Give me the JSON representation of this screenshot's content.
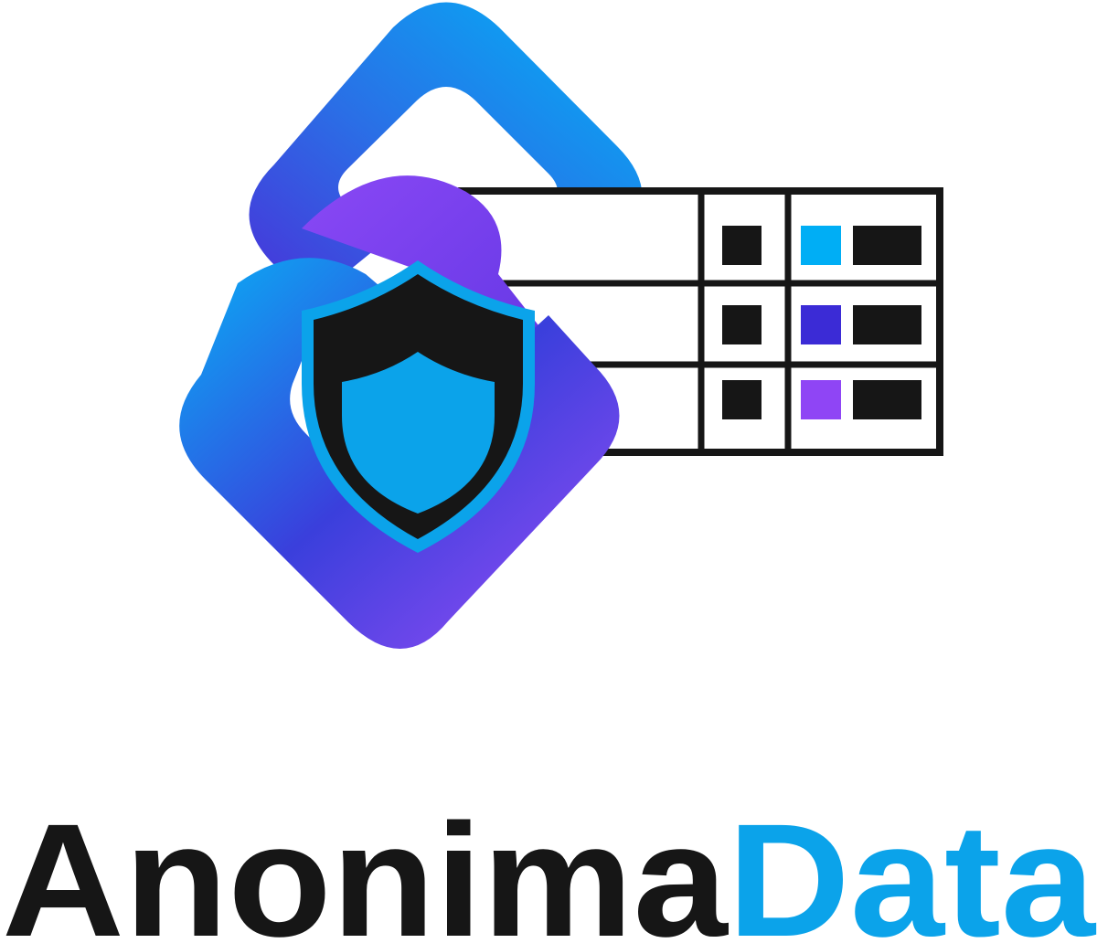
{
  "brand": {
    "name_part1": "Anonima",
    "name_part2": "Data"
  },
  "colors": {
    "text_dark": "#161616",
    "accent_blue": "#0ba3ea",
    "cyan": "#00aef5",
    "indigo": "#3b2bd6",
    "purple": "#8f45f5"
  },
  "icons": [
    "chain-link-icon",
    "shield-icon",
    "data-table-icon"
  ]
}
